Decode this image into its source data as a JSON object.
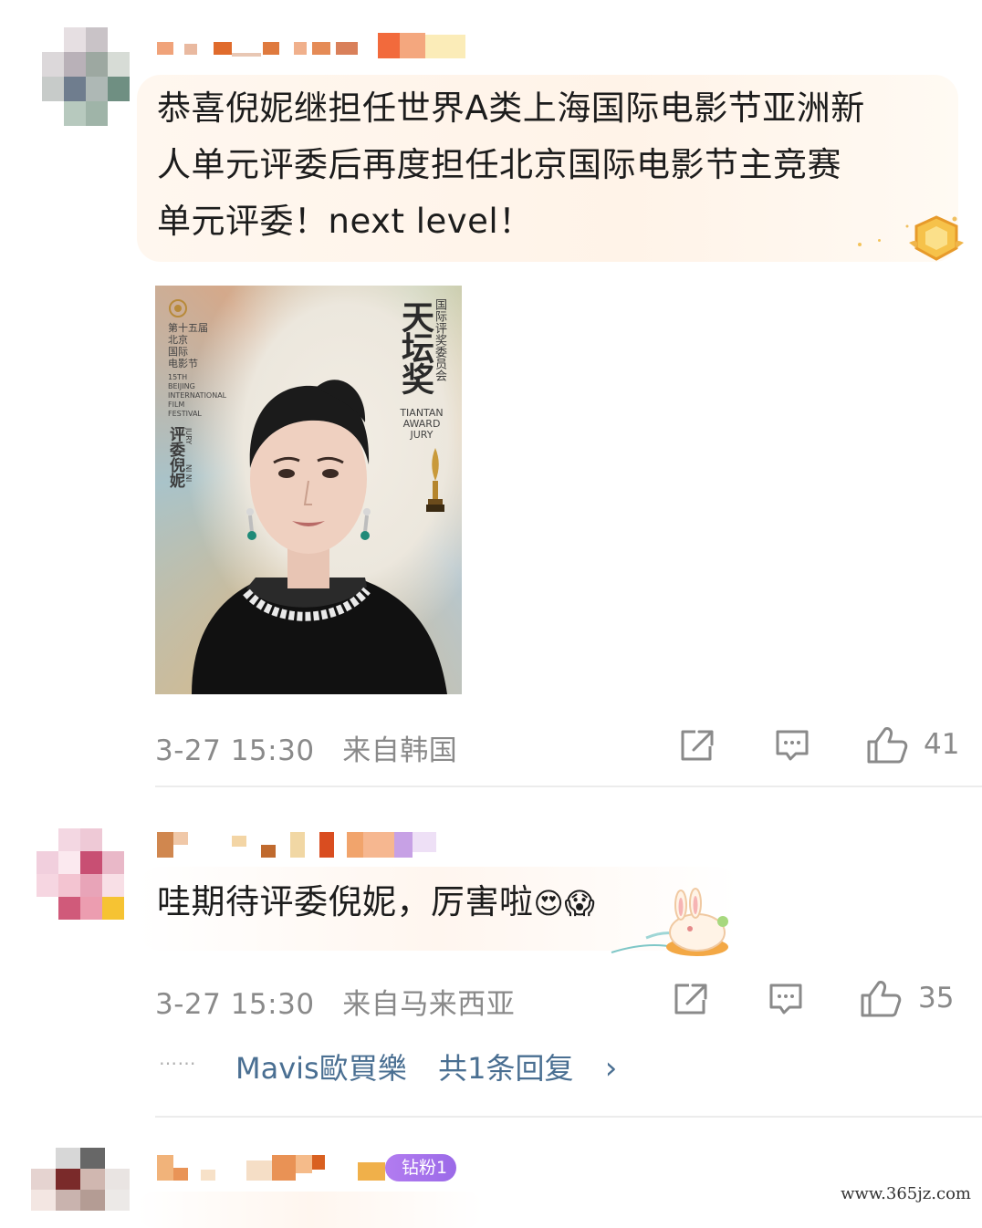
{
  "comments": [
    {
      "text": "恭喜倪妮继担任世界A类上海国际电影节亚洲新人单元评委后再度担任北京国际电影节主竞赛单元评委！next level！",
      "lines": [
        "恭喜倪妮继担任世界A类上海国际电影节亚洲新",
        "人单元评委后再度担任北京国际电影节主竞赛",
        "单元评委！next level！"
      ],
      "timestamp": "3-27 15:30",
      "location": "来自韩国",
      "likes": "41"
    },
    {
      "text": "哇期待评委倪妮，厉害啦",
      "emoji": "😍😱",
      "timestamp": "3-27 15:30",
      "location": "来自马来西亚",
      "likes": "35",
      "reply_dots": "……",
      "reply_user": "Mavis歐買樂",
      "reply_summary": "共1条回复",
      "reply_chevron": "›"
    },
    {
      "badge": "钻粉1"
    }
  ],
  "poster": {
    "edition_lines": [
      "第十五届",
      "北京",
      "国际",
      "电影节"
    ],
    "edition_en": [
      "15TH",
      "BEIJING",
      "INTERNATIONAL",
      "FILM",
      "FESTIVAL"
    ],
    "jury_cn": "评委倪妮",
    "jury_en": "JURY",
    "jury_name_en": "NI NI",
    "award_title": "天坛奖",
    "committee": "国际评奖委员会",
    "award_en": [
      "TIANTAN",
      "AWARD",
      "JURY"
    ]
  },
  "icons": [
    "share-icon",
    "comment-icon",
    "like-icon"
  ],
  "colors": {
    "meta_gray": "#8a8a8a",
    "link_blue": "#4a6f92",
    "badge_purple": "#a874ee"
  },
  "watermark": "www.365jz.com"
}
